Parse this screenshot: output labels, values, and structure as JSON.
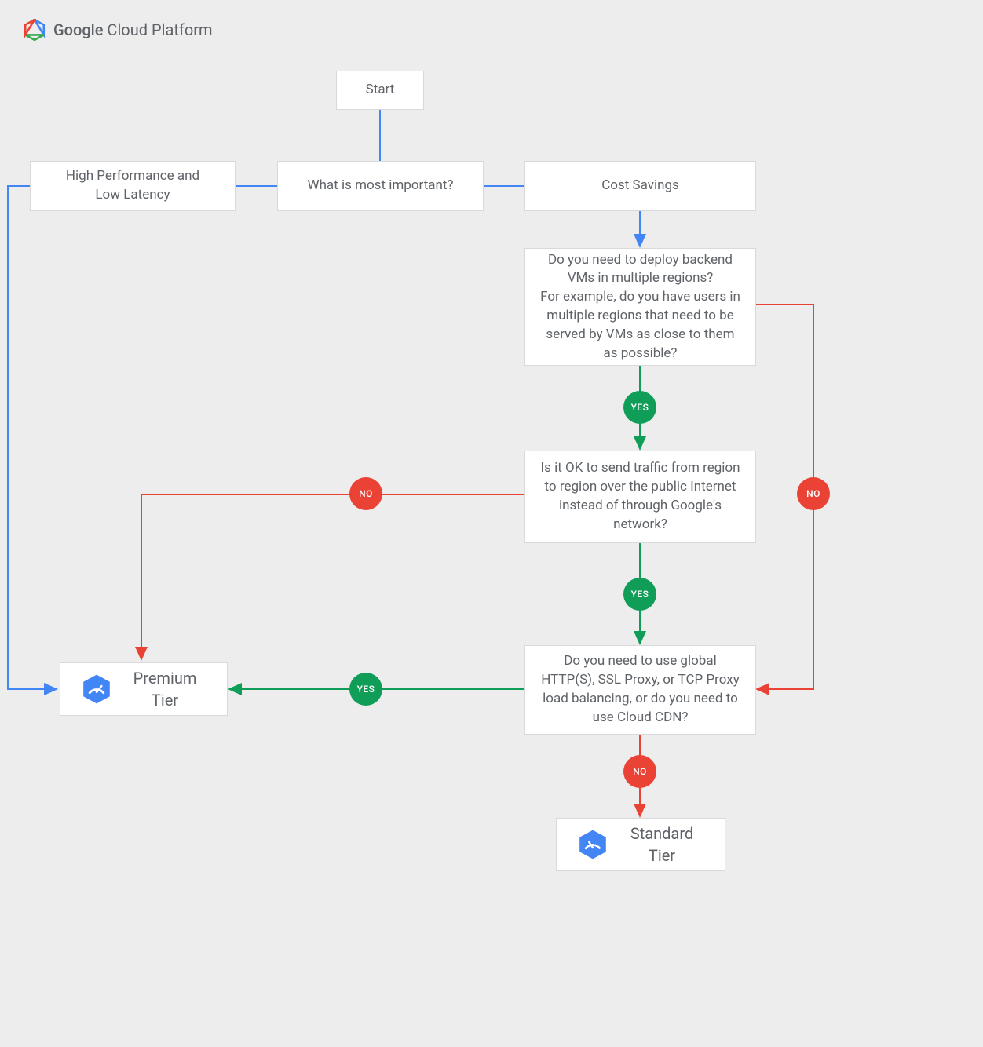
{
  "header": {
    "brand_bold": "Google",
    "brand_rest": " Cloud Platform"
  },
  "nodes": {
    "start": "Start",
    "hpll": "High Performance and Low Latency",
    "q_important": "What is most important?",
    "cost_savings": "Cost Savings",
    "q_regions": "Do you need to deploy backend VMs in multiple regions?\nFor example, do you have users in multiple regions that need to be served by VMs as close to them as possible?",
    "q_internet": "Is it OK to send traffic from region to region over the public Internet instead of through Google's network?",
    "q_global_lb": "Do you need to use global HTTP(S), SSL Proxy, or TCP Proxy load balancing, or do you need to use Cloud CDN?",
    "premium": "Premium Tier",
    "standard": "Standard Tier"
  },
  "badges": {
    "yes": "YES",
    "no": "NO"
  },
  "colors": {
    "blue": "#4285f4",
    "green": "#0f9d58",
    "red": "#ea4335",
    "grey": "#5f6368"
  }
}
